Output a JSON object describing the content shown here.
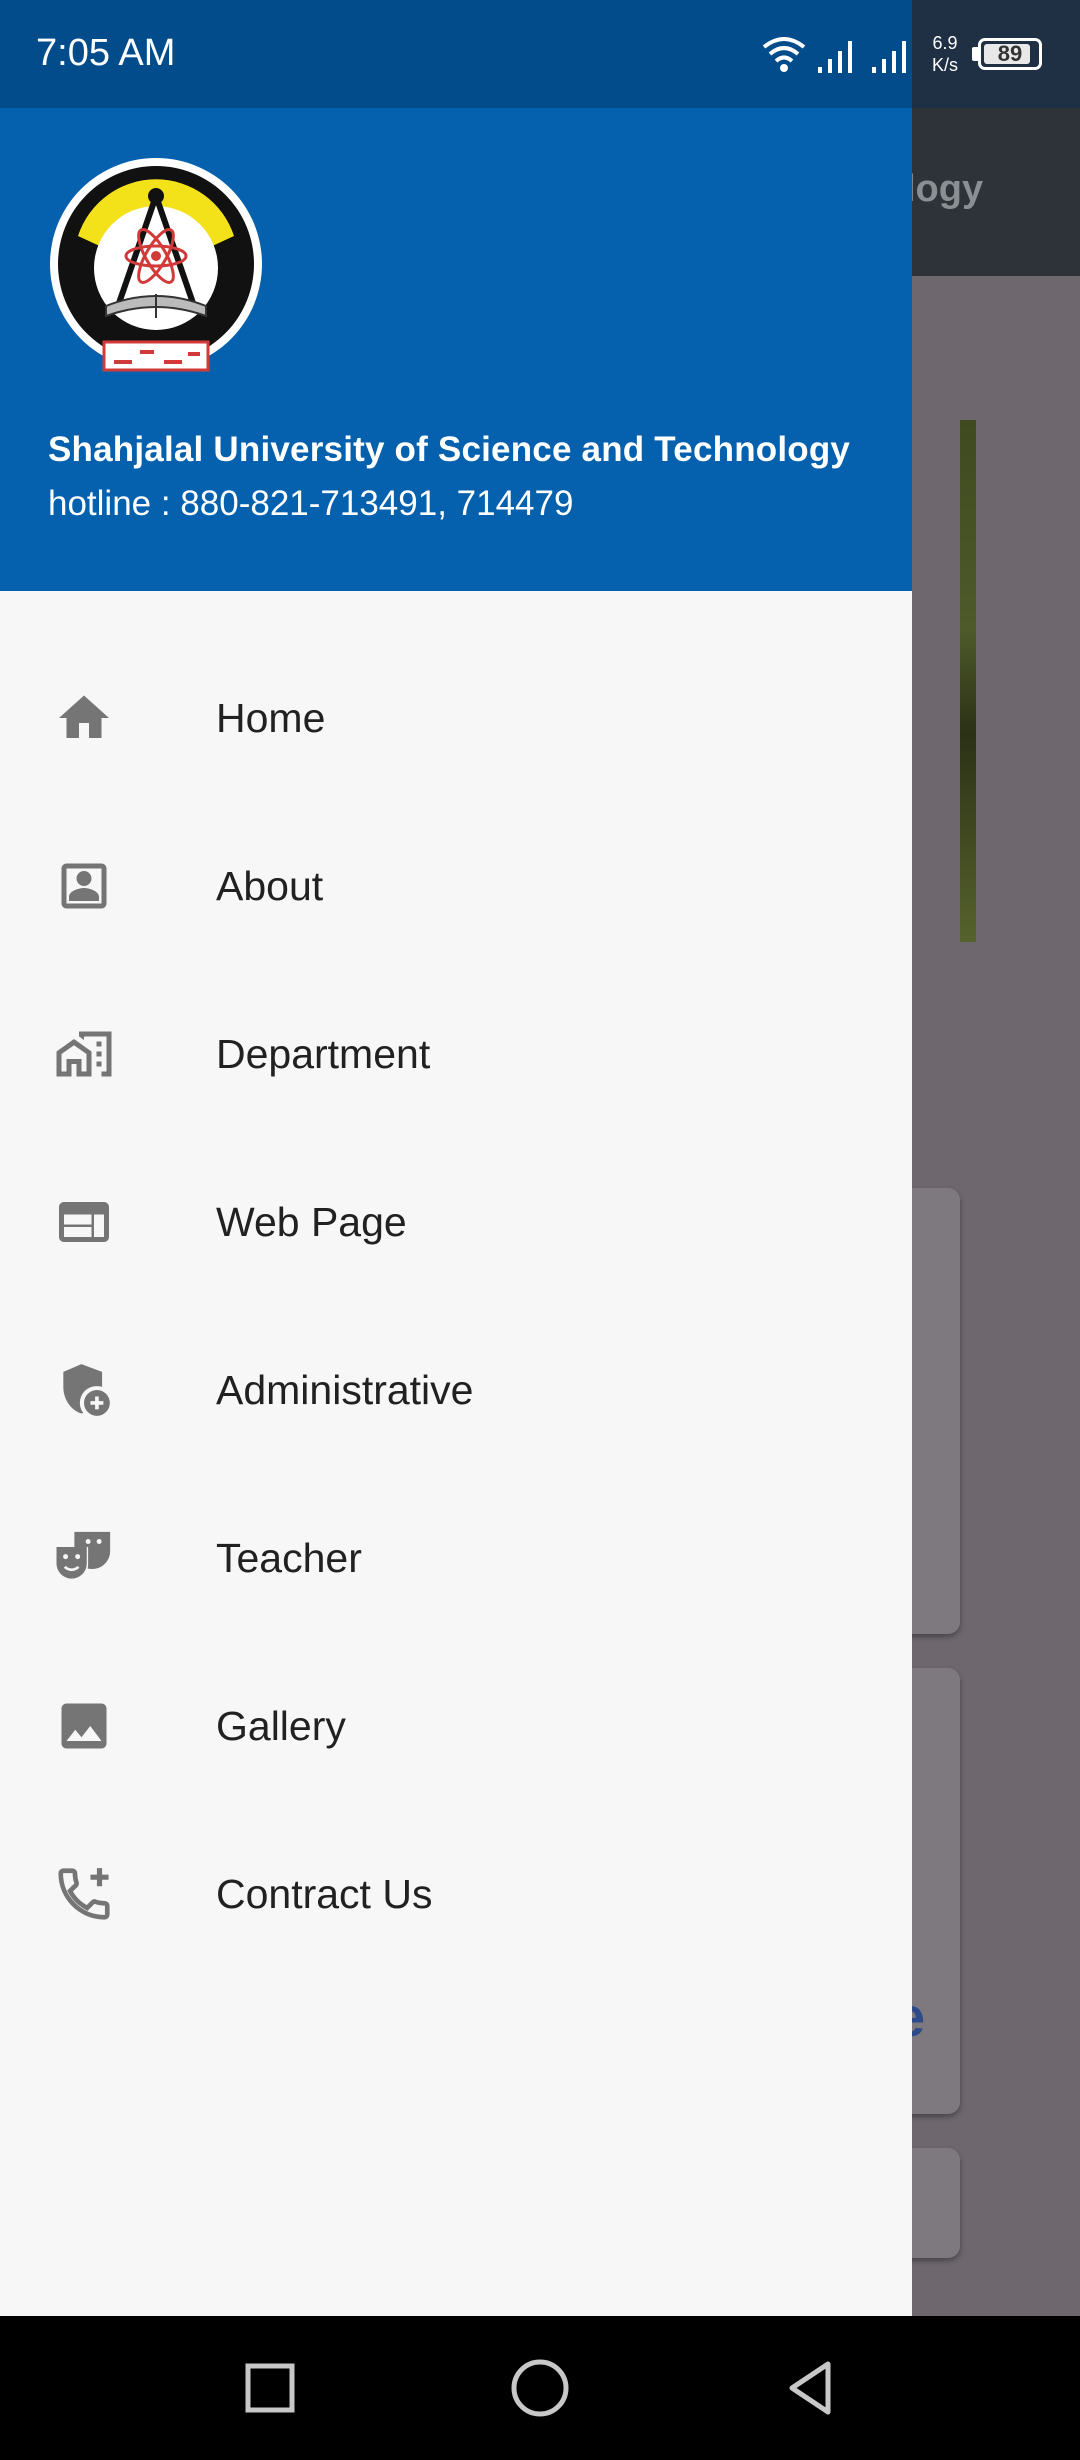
{
  "status_bar": {
    "time": "7:05 AM",
    "net_speed_value": "6.9",
    "net_speed_unit": "K/s",
    "battery": "89",
    "battery_level": 0.89,
    "icons": [
      "wifi-icon",
      "signal-icon",
      "signal-icon",
      "battery-icon"
    ]
  },
  "background": {
    "appbar_title_fragment": "logy",
    "card_fragment": "e"
  },
  "drawer": {
    "header": {
      "university_name": "Shahjalal University of Science and Technology",
      "hotline": "hotline : 880-821-713491, 714479",
      "logo": "sust-logo"
    },
    "menu": [
      {
        "label": "Home",
        "icon": "home-icon"
      },
      {
        "label": "About",
        "icon": "contact-card-icon"
      },
      {
        "label": "Department",
        "icon": "domain-icon"
      },
      {
        "label": "Web Page",
        "icon": "web-icon"
      },
      {
        "label": "Administrative",
        "icon": "admin-shield-icon"
      },
      {
        "label": "Teacher",
        "icon": "theater-masks-icon"
      },
      {
        "label": "Gallery",
        "icon": "image-icon"
      },
      {
        "label": "Contract Us",
        "icon": "add-call-icon"
      }
    ]
  },
  "nav_bar": {
    "buttons": [
      "recents-button",
      "home-button",
      "back-button"
    ]
  },
  "colors": {
    "header_blue": "#0560ad",
    "status_blue": "#034c8c",
    "icon_grey": "#757575",
    "drawer_bg": "#f7f7f7"
  }
}
